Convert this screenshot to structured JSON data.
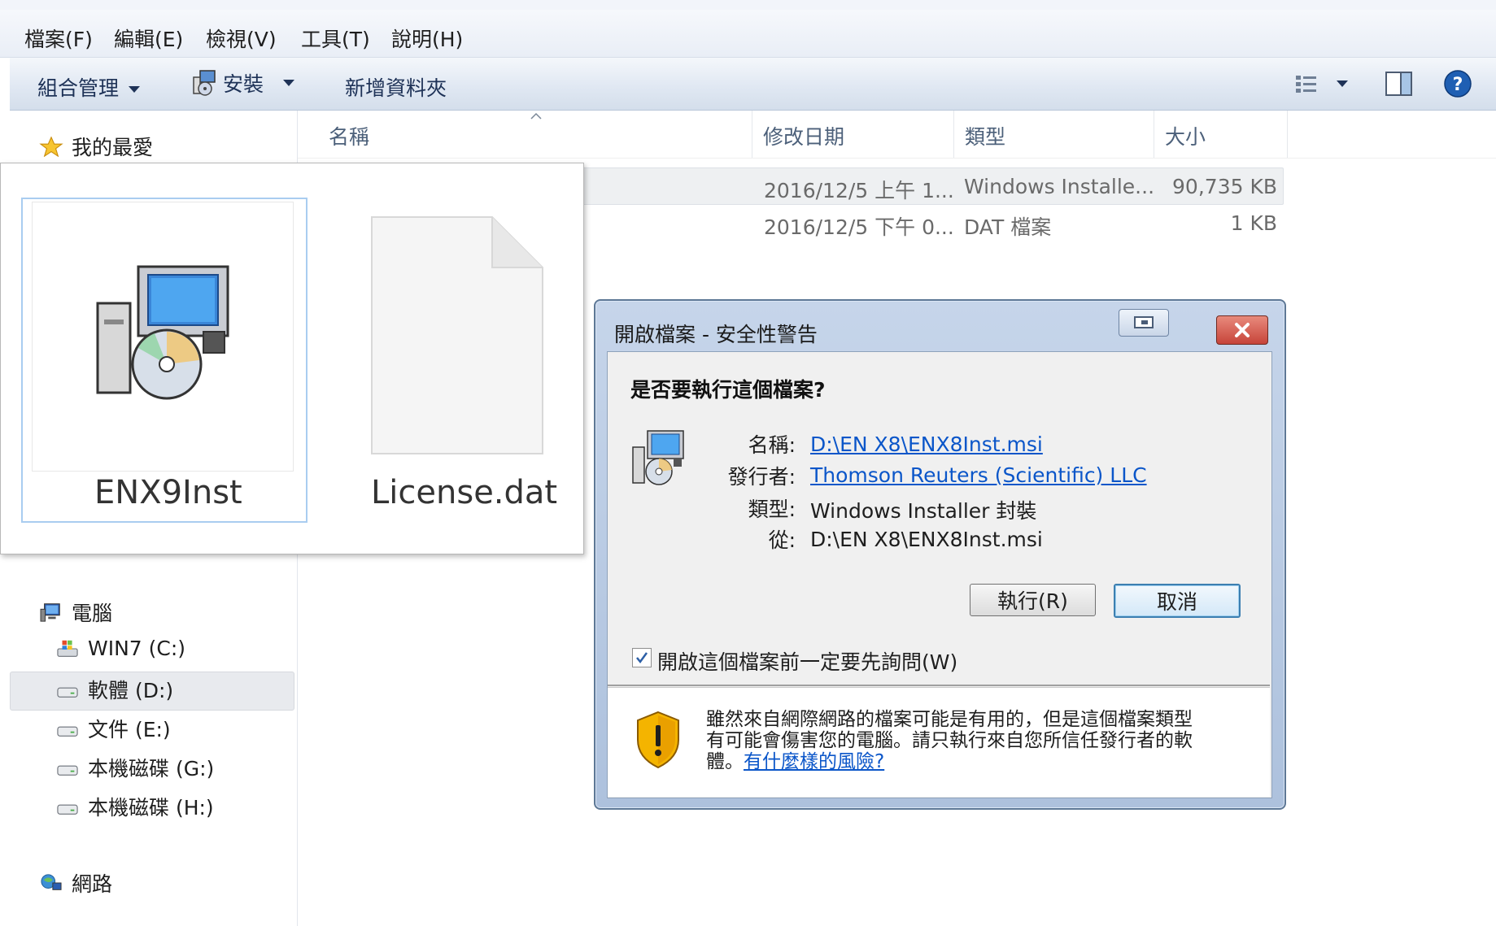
{
  "menubar": {
    "items": [
      "檔案(F)",
      "編輯(E)",
      "檢視(V)",
      "工具(T)",
      "說明(H)"
    ]
  },
  "toolbar": {
    "organize": "組合管理",
    "install": "安裝",
    "new_folder": "新增資料夾"
  },
  "nav": {
    "favorites": "我的最愛",
    "computer": "電腦",
    "drives": [
      "WIN7 (C:)",
      "軟體 (D:)",
      "文件 (E:)",
      "本機磁碟 (G:)",
      "本機磁碟 (H:)"
    ],
    "selected_drive": "軟體 (D:)",
    "network": "網路"
  },
  "columns": {
    "name": "名稱",
    "date": "修改日期",
    "type": "類型",
    "size": "大小"
  },
  "files": [
    {
      "date": "2016/12/5 上午 1...",
      "type": "Windows Installe...",
      "size": "90,735 KB"
    },
    {
      "date": "2016/12/5 下午 0...",
      "type": "DAT 檔案",
      "size": "1 KB"
    }
  ],
  "zoom": {
    "item1_label": "ENX9Inst",
    "item2_label": "License.dat"
  },
  "dialog": {
    "title": "開啟檔案 - 安全性警告",
    "question": "是否要執行這個檔案?",
    "name_label": "名稱:",
    "name_value": "D:\\EN X8\\ENX8Inst.msi",
    "publisher_label": "發行者:",
    "publisher_value": "Thomson Reuters (Scientific) LLC",
    "type_label": "類型:",
    "type_value": "Windows Installer 封裝",
    "from_label": "從:",
    "from_value": "D:\\EN X8\\ENX8Inst.msi",
    "run_button": "執行(R)",
    "cancel_button": "取消",
    "checkbox_label": "開啟這個檔案前一定要先詢問(W)",
    "checkbox_checked": true,
    "warning_line1": "雖然來自網際網路的檔案可能是有用的，但是這個檔案類型",
    "warning_line2": "有可能會傷害您的電腦。請只執行來自您所信任發行者的軟",
    "warning_line3_prefix": "體。",
    "warning_link": "有什麼樣的風險?"
  },
  "colors": {
    "link": "#0b56c9",
    "dialog_frame": "#adc1dd",
    "close_button": "#c7443a"
  }
}
